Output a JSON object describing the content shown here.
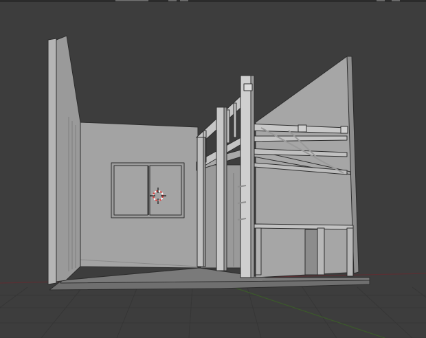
{
  "viewport": {
    "background": "#3d3d3d",
    "grid_color": "#353535",
    "axis_x_color": "#5a2f33",
    "axis_y_color": "#3b5a2a",
    "mesh_light": "#a3a3a3",
    "mesh_mid": "#8e8e8e",
    "mesh_dark": "#6f6f6f",
    "edge_color": "#2d2d2d"
  },
  "overlay_icons": [
    "3d-cursor-icon"
  ]
}
